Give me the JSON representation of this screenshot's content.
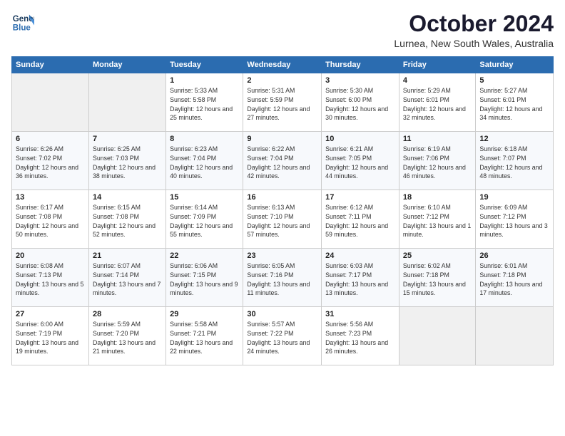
{
  "header": {
    "logo_line1": "General",
    "logo_line2": "Blue",
    "month": "October 2024",
    "location": "Lurnea, New South Wales, Australia"
  },
  "days_of_week": [
    "Sunday",
    "Monday",
    "Tuesday",
    "Wednesday",
    "Thursday",
    "Friday",
    "Saturday"
  ],
  "weeks": [
    [
      {
        "day": "",
        "sunrise": "",
        "sunset": "",
        "daylight": ""
      },
      {
        "day": "",
        "sunrise": "",
        "sunset": "",
        "daylight": ""
      },
      {
        "day": "1",
        "sunrise": "Sunrise: 5:33 AM",
        "sunset": "Sunset: 5:58 PM",
        "daylight": "Daylight: 12 hours and 25 minutes."
      },
      {
        "day": "2",
        "sunrise": "Sunrise: 5:31 AM",
        "sunset": "Sunset: 5:59 PM",
        "daylight": "Daylight: 12 hours and 27 minutes."
      },
      {
        "day": "3",
        "sunrise": "Sunrise: 5:30 AM",
        "sunset": "Sunset: 6:00 PM",
        "daylight": "Daylight: 12 hours and 30 minutes."
      },
      {
        "day": "4",
        "sunrise": "Sunrise: 5:29 AM",
        "sunset": "Sunset: 6:01 PM",
        "daylight": "Daylight: 12 hours and 32 minutes."
      },
      {
        "day": "5",
        "sunrise": "Sunrise: 5:27 AM",
        "sunset": "Sunset: 6:01 PM",
        "daylight": "Daylight: 12 hours and 34 minutes."
      }
    ],
    [
      {
        "day": "6",
        "sunrise": "Sunrise: 6:26 AM",
        "sunset": "Sunset: 7:02 PM",
        "daylight": "Daylight: 12 hours and 36 minutes."
      },
      {
        "day": "7",
        "sunrise": "Sunrise: 6:25 AM",
        "sunset": "Sunset: 7:03 PM",
        "daylight": "Daylight: 12 hours and 38 minutes."
      },
      {
        "day": "8",
        "sunrise": "Sunrise: 6:23 AM",
        "sunset": "Sunset: 7:04 PM",
        "daylight": "Daylight: 12 hours and 40 minutes."
      },
      {
        "day": "9",
        "sunrise": "Sunrise: 6:22 AM",
        "sunset": "Sunset: 7:04 PM",
        "daylight": "Daylight: 12 hours and 42 minutes."
      },
      {
        "day": "10",
        "sunrise": "Sunrise: 6:21 AM",
        "sunset": "Sunset: 7:05 PM",
        "daylight": "Daylight: 12 hours and 44 minutes."
      },
      {
        "day": "11",
        "sunrise": "Sunrise: 6:19 AM",
        "sunset": "Sunset: 7:06 PM",
        "daylight": "Daylight: 12 hours and 46 minutes."
      },
      {
        "day": "12",
        "sunrise": "Sunrise: 6:18 AM",
        "sunset": "Sunset: 7:07 PM",
        "daylight": "Daylight: 12 hours and 48 minutes."
      }
    ],
    [
      {
        "day": "13",
        "sunrise": "Sunrise: 6:17 AM",
        "sunset": "Sunset: 7:08 PM",
        "daylight": "Daylight: 12 hours and 50 minutes."
      },
      {
        "day": "14",
        "sunrise": "Sunrise: 6:15 AM",
        "sunset": "Sunset: 7:08 PM",
        "daylight": "Daylight: 12 hours and 52 minutes."
      },
      {
        "day": "15",
        "sunrise": "Sunrise: 6:14 AM",
        "sunset": "Sunset: 7:09 PM",
        "daylight": "Daylight: 12 hours and 55 minutes."
      },
      {
        "day": "16",
        "sunrise": "Sunrise: 6:13 AM",
        "sunset": "Sunset: 7:10 PM",
        "daylight": "Daylight: 12 hours and 57 minutes."
      },
      {
        "day": "17",
        "sunrise": "Sunrise: 6:12 AM",
        "sunset": "Sunset: 7:11 PM",
        "daylight": "Daylight: 12 hours and 59 minutes."
      },
      {
        "day": "18",
        "sunrise": "Sunrise: 6:10 AM",
        "sunset": "Sunset: 7:12 PM",
        "daylight": "Daylight: 13 hours and 1 minute."
      },
      {
        "day": "19",
        "sunrise": "Sunrise: 6:09 AM",
        "sunset": "Sunset: 7:12 PM",
        "daylight": "Daylight: 13 hours and 3 minutes."
      }
    ],
    [
      {
        "day": "20",
        "sunrise": "Sunrise: 6:08 AM",
        "sunset": "Sunset: 7:13 PM",
        "daylight": "Daylight: 13 hours and 5 minutes."
      },
      {
        "day": "21",
        "sunrise": "Sunrise: 6:07 AM",
        "sunset": "Sunset: 7:14 PM",
        "daylight": "Daylight: 13 hours and 7 minutes."
      },
      {
        "day": "22",
        "sunrise": "Sunrise: 6:06 AM",
        "sunset": "Sunset: 7:15 PM",
        "daylight": "Daylight: 13 hours and 9 minutes."
      },
      {
        "day": "23",
        "sunrise": "Sunrise: 6:05 AM",
        "sunset": "Sunset: 7:16 PM",
        "daylight": "Daylight: 13 hours and 11 minutes."
      },
      {
        "day": "24",
        "sunrise": "Sunrise: 6:03 AM",
        "sunset": "Sunset: 7:17 PM",
        "daylight": "Daylight: 13 hours and 13 minutes."
      },
      {
        "day": "25",
        "sunrise": "Sunrise: 6:02 AM",
        "sunset": "Sunset: 7:18 PM",
        "daylight": "Daylight: 13 hours and 15 minutes."
      },
      {
        "day": "26",
        "sunrise": "Sunrise: 6:01 AM",
        "sunset": "Sunset: 7:18 PM",
        "daylight": "Daylight: 13 hours and 17 minutes."
      }
    ],
    [
      {
        "day": "27",
        "sunrise": "Sunrise: 6:00 AM",
        "sunset": "Sunset: 7:19 PM",
        "daylight": "Daylight: 13 hours and 19 minutes."
      },
      {
        "day": "28",
        "sunrise": "Sunrise: 5:59 AM",
        "sunset": "Sunset: 7:20 PM",
        "daylight": "Daylight: 13 hours and 21 minutes."
      },
      {
        "day": "29",
        "sunrise": "Sunrise: 5:58 AM",
        "sunset": "Sunset: 7:21 PM",
        "daylight": "Daylight: 13 hours and 22 minutes."
      },
      {
        "day": "30",
        "sunrise": "Sunrise: 5:57 AM",
        "sunset": "Sunset: 7:22 PM",
        "daylight": "Daylight: 13 hours and 24 minutes."
      },
      {
        "day": "31",
        "sunrise": "Sunrise: 5:56 AM",
        "sunset": "Sunset: 7:23 PM",
        "daylight": "Daylight: 13 hours and 26 minutes."
      },
      {
        "day": "",
        "sunrise": "",
        "sunset": "",
        "daylight": ""
      },
      {
        "day": "",
        "sunrise": "",
        "sunset": "",
        "daylight": ""
      }
    ]
  ]
}
